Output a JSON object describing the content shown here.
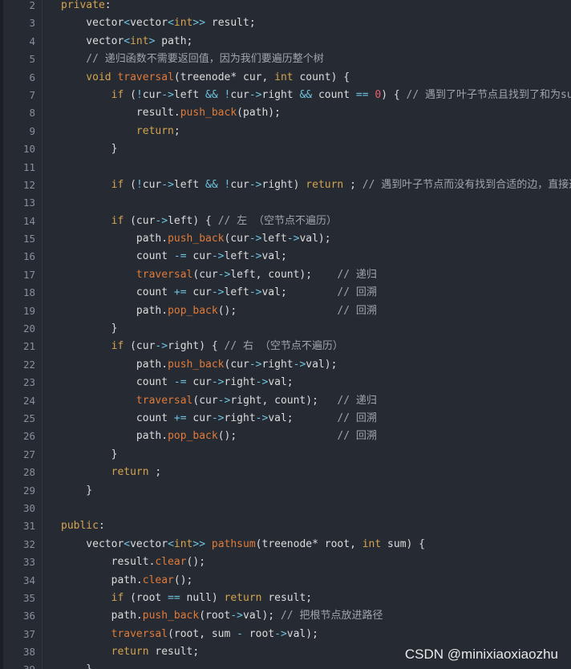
{
  "watermark": "CSDN @minixiaoxiaozhu",
  "lines": [
    {
      "n": "2",
      "segs": [
        [
          "c-kw",
          "private"
        ],
        [
          "",
          ":"
        ]
      ]
    },
    {
      "n": "3",
      "segs": [
        [
          "",
          "    vector"
        ],
        [
          "c-op",
          "<"
        ],
        [
          "",
          "vector"
        ],
        [
          "c-op",
          "<"
        ],
        [
          "c-kw",
          "int"
        ],
        [
          "c-op",
          ">>"
        ],
        [
          "",
          " result;"
        ]
      ]
    },
    {
      "n": "4",
      "segs": [
        [
          "",
          "    vector"
        ],
        [
          "c-op",
          "<"
        ],
        [
          "c-kw",
          "int"
        ],
        [
          "c-op",
          ">"
        ],
        [
          "",
          " path;"
        ]
      ]
    },
    {
      "n": "5",
      "segs": [
        [
          "c-cm",
          "    // 递归函数不需要返回值，因为我们要遍历整个树"
        ]
      ]
    },
    {
      "n": "6",
      "segs": [
        [
          "c-kw",
          "    void"
        ],
        [
          "",
          " "
        ],
        [
          "c-fn",
          "traversal"
        ],
        [
          "",
          "(treenode* cur, "
        ],
        [
          "c-kw",
          "int"
        ],
        [
          "",
          " count) {"
        ]
      ]
    },
    {
      "n": "7",
      "segs": [
        [
          "c-kw",
          "        if"
        ],
        [
          "",
          " ("
        ],
        [
          "c-op",
          "!"
        ],
        [
          "",
          "cur"
        ],
        [
          "c-op",
          "->"
        ],
        [
          "",
          "left "
        ],
        [
          "c-op",
          "&&"
        ],
        [
          "",
          " "
        ],
        [
          "c-op",
          "!"
        ],
        [
          "",
          "cur"
        ],
        [
          "c-op",
          "->"
        ],
        [
          "",
          "right "
        ],
        [
          "c-op",
          "&&"
        ],
        [
          "",
          " count "
        ],
        [
          "c-op",
          "=="
        ],
        [
          "",
          " "
        ],
        [
          "c-num",
          "0"
        ],
        [
          "",
          ") { "
        ],
        [
          "c-cm",
          "// 遇到了叶子节点且找到了和为sum的路径"
        ]
      ]
    },
    {
      "n": "8",
      "segs": [
        [
          "",
          "            result."
        ],
        [
          "c-fn",
          "push_back"
        ],
        [
          "",
          "(path);"
        ]
      ]
    },
    {
      "n": "9",
      "segs": [
        [
          "c-kw",
          "            return"
        ],
        [
          "",
          ";"
        ]
      ]
    },
    {
      "n": "10",
      "segs": [
        [
          "",
          "        }"
        ]
      ]
    },
    {
      "n": "11",
      "segs": [
        [
          "",
          ""
        ]
      ]
    },
    {
      "n": "12",
      "segs": [
        [
          "c-kw",
          "        if"
        ],
        [
          "",
          " ("
        ],
        [
          "c-op",
          "!"
        ],
        [
          "",
          "cur"
        ],
        [
          "c-op",
          "->"
        ],
        [
          "",
          "left "
        ],
        [
          "c-op",
          "&&"
        ],
        [
          "",
          " "
        ],
        [
          "c-op",
          "!"
        ],
        [
          "",
          "cur"
        ],
        [
          "c-op",
          "->"
        ],
        [
          "",
          "right) "
        ],
        [
          "c-kw",
          "return"
        ],
        [
          "",
          " ; "
        ],
        [
          "c-cm",
          "// 遇到叶子节点而没有找到合适的边，直接返回"
        ]
      ]
    },
    {
      "n": "13",
      "segs": [
        [
          "",
          ""
        ]
      ]
    },
    {
      "n": "14",
      "segs": [
        [
          "c-kw",
          "        if"
        ],
        [
          "",
          " (cur"
        ],
        [
          "c-op",
          "->"
        ],
        [
          "",
          "left) { "
        ],
        [
          "c-cm",
          "// 左 （空节点不遍历）"
        ]
      ]
    },
    {
      "n": "15",
      "segs": [
        [
          "",
          "            path."
        ],
        [
          "c-fn",
          "push_back"
        ],
        [
          "",
          "(cur"
        ],
        [
          "c-op",
          "->"
        ],
        [
          "",
          "left"
        ],
        [
          "c-op",
          "->"
        ],
        [
          "",
          "val);"
        ]
      ]
    },
    {
      "n": "16",
      "segs": [
        [
          "",
          "            count "
        ],
        [
          "c-op",
          "-="
        ],
        [
          "",
          " cur"
        ],
        [
          "c-op",
          "->"
        ],
        [
          "",
          "left"
        ],
        [
          "c-op",
          "->"
        ],
        [
          "",
          "val;"
        ]
      ]
    },
    {
      "n": "17",
      "segs": [
        [
          "c-fn",
          "            traversal"
        ],
        [
          "",
          "(cur"
        ],
        [
          "c-op",
          "->"
        ],
        [
          "",
          "left, count);    "
        ],
        [
          "c-cm",
          "// 递归"
        ]
      ]
    },
    {
      "n": "18",
      "segs": [
        [
          "",
          "            count "
        ],
        [
          "c-op",
          "+="
        ],
        [
          "",
          " cur"
        ],
        [
          "c-op",
          "->"
        ],
        [
          "",
          "left"
        ],
        [
          "c-op",
          "->"
        ],
        [
          "",
          "val;        "
        ],
        [
          "c-cm",
          "// 回溯"
        ]
      ]
    },
    {
      "n": "19",
      "segs": [
        [
          "",
          "            path."
        ],
        [
          "c-fn",
          "pop_back"
        ],
        [
          "",
          "();                "
        ],
        [
          "c-cm",
          "// 回溯"
        ]
      ]
    },
    {
      "n": "20",
      "segs": [
        [
          "",
          "        }"
        ]
      ]
    },
    {
      "n": "21",
      "segs": [
        [
          "c-kw",
          "        if"
        ],
        [
          "",
          " (cur"
        ],
        [
          "c-op",
          "->"
        ],
        [
          "",
          "right) { "
        ],
        [
          "c-cm",
          "// 右 （空节点不遍历）"
        ]
      ]
    },
    {
      "n": "22",
      "segs": [
        [
          "",
          "            path."
        ],
        [
          "c-fn",
          "push_back"
        ],
        [
          "",
          "(cur"
        ],
        [
          "c-op",
          "->"
        ],
        [
          "",
          "right"
        ],
        [
          "c-op",
          "->"
        ],
        [
          "",
          "val);"
        ]
      ]
    },
    {
      "n": "23",
      "segs": [
        [
          "",
          "            count "
        ],
        [
          "c-op",
          "-="
        ],
        [
          "",
          " cur"
        ],
        [
          "c-op",
          "->"
        ],
        [
          "",
          "right"
        ],
        [
          "c-op",
          "->"
        ],
        [
          "",
          "val;"
        ]
      ]
    },
    {
      "n": "24",
      "segs": [
        [
          "c-fn",
          "            traversal"
        ],
        [
          "",
          "(cur"
        ],
        [
          "c-op",
          "->"
        ],
        [
          "",
          "right, count);   "
        ],
        [
          "c-cm",
          "// 递归"
        ]
      ]
    },
    {
      "n": "25",
      "segs": [
        [
          "",
          "            count "
        ],
        [
          "c-op",
          "+="
        ],
        [
          "",
          " cur"
        ],
        [
          "c-op",
          "->"
        ],
        [
          "",
          "right"
        ],
        [
          "c-op",
          "->"
        ],
        [
          "",
          "val;       "
        ],
        [
          "c-cm",
          "// 回溯"
        ]
      ]
    },
    {
      "n": "26",
      "segs": [
        [
          "",
          "            path."
        ],
        [
          "c-fn",
          "pop_back"
        ],
        [
          "",
          "();                "
        ],
        [
          "c-cm",
          "// 回溯"
        ]
      ]
    },
    {
      "n": "27",
      "segs": [
        [
          "",
          "        }"
        ]
      ]
    },
    {
      "n": "28",
      "segs": [
        [
          "c-kw",
          "        return"
        ],
        [
          "",
          " ;"
        ]
      ]
    },
    {
      "n": "29",
      "segs": [
        [
          "",
          "    }"
        ]
      ]
    },
    {
      "n": "30",
      "segs": [
        [
          "",
          ""
        ]
      ]
    },
    {
      "n": "31",
      "segs": [
        [
          "c-kw",
          "public"
        ],
        [
          "",
          ":"
        ]
      ]
    },
    {
      "n": "32",
      "segs": [
        [
          "",
          "    vector"
        ],
        [
          "c-op",
          "<"
        ],
        [
          "",
          "vector"
        ],
        [
          "c-op",
          "<"
        ],
        [
          "c-kw",
          "int"
        ],
        [
          "c-op",
          ">>"
        ],
        [
          "",
          " "
        ],
        [
          "c-fn",
          "pathsum"
        ],
        [
          "",
          "(treenode* root, "
        ],
        [
          "c-kw",
          "int"
        ],
        [
          "",
          " sum) {"
        ]
      ]
    },
    {
      "n": "33",
      "segs": [
        [
          "",
          "        result."
        ],
        [
          "c-fn",
          "clear"
        ],
        [
          "",
          "();"
        ]
      ]
    },
    {
      "n": "34",
      "segs": [
        [
          "",
          "        path."
        ],
        [
          "c-fn",
          "clear"
        ],
        [
          "",
          "();"
        ]
      ]
    },
    {
      "n": "35",
      "segs": [
        [
          "c-kw",
          "        if"
        ],
        [
          "",
          " (root "
        ],
        [
          "c-op",
          "=="
        ],
        [
          "",
          " null) "
        ],
        [
          "c-kw",
          "return"
        ],
        [
          "",
          " result;"
        ]
      ]
    },
    {
      "n": "36",
      "segs": [
        [
          "",
          "        path."
        ],
        [
          "c-fn",
          "push_back"
        ],
        [
          "",
          "(root"
        ],
        [
          "c-op",
          "->"
        ],
        [
          "",
          "val); "
        ],
        [
          "c-cm",
          "// 把根节点放进路径"
        ]
      ]
    },
    {
      "n": "37",
      "segs": [
        [
          "c-fn",
          "        traversal"
        ],
        [
          "",
          "(root, sum "
        ],
        [
          "c-op",
          "-"
        ],
        [
          "",
          " root"
        ],
        [
          "c-op",
          "->"
        ],
        [
          "",
          "val);"
        ]
      ]
    },
    {
      "n": "38",
      "segs": [
        [
          "c-kw",
          "        return"
        ],
        [
          "",
          " result;"
        ]
      ]
    },
    {
      "n": "39",
      "segs": [
        [
          "",
          "    }"
        ]
      ]
    }
  ]
}
